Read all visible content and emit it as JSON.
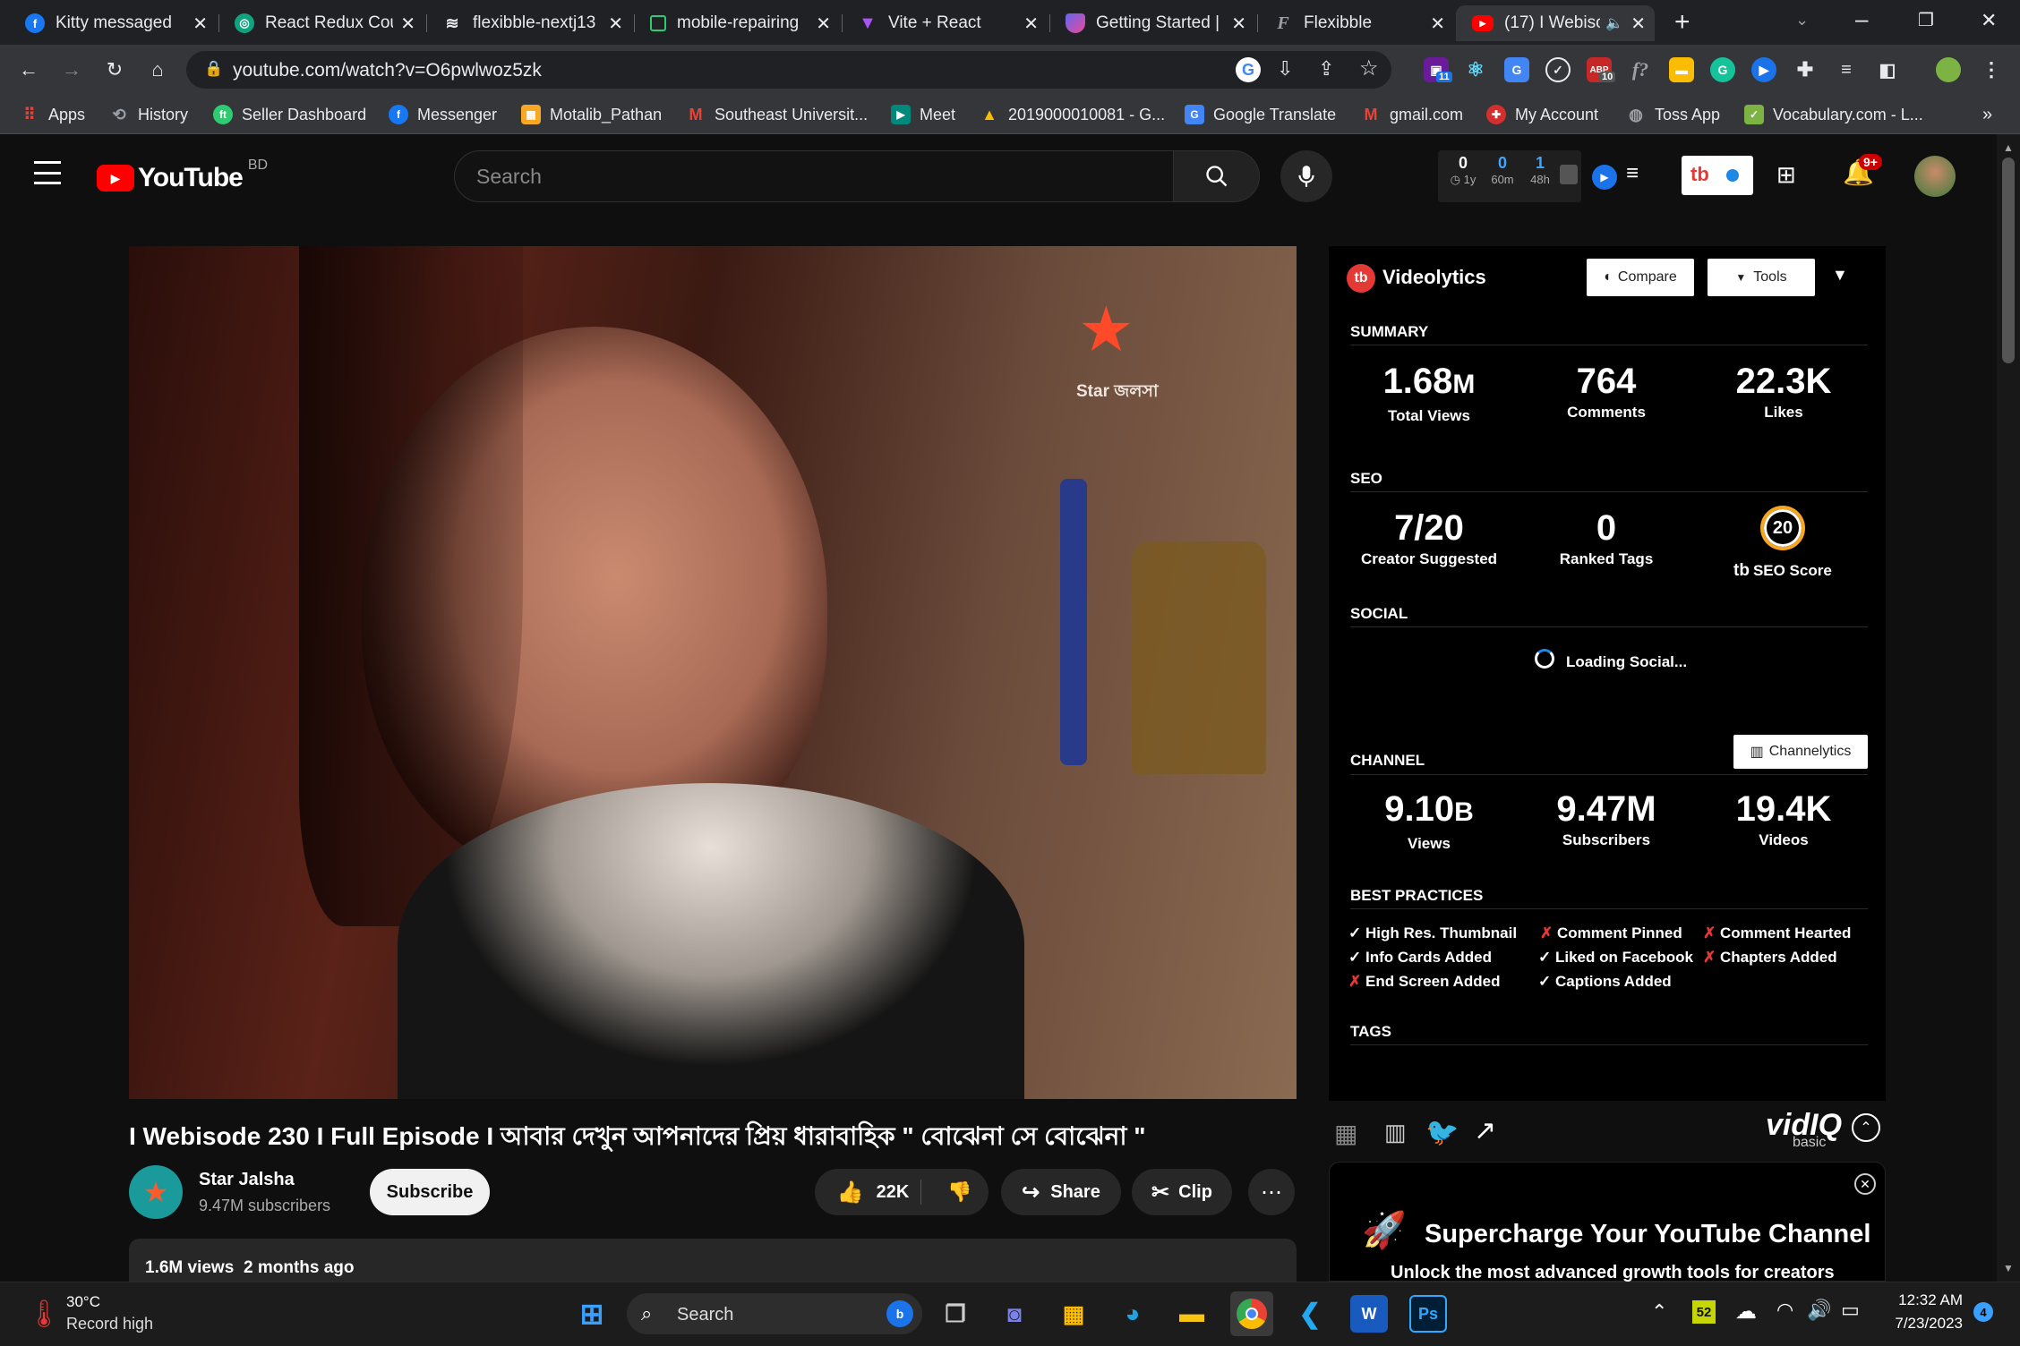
{
  "browser": {
    "tabs": [
      {
        "title": "Kitty messaged",
        "icon": "facebook-icon",
        "color": "#1877f2"
      },
      {
        "title": "React Redux Cou",
        "icon": "chatgpt-icon",
        "color": "#10a37f"
      },
      {
        "title": "flexibble-nextj13",
        "icon": "layers-icon",
        "color": "#e8eaed"
      },
      {
        "title": "mobile-repairing",
        "icon": "codesandbox-icon",
        "color": "#2ecc71"
      },
      {
        "title": "Vite + React",
        "icon": "vite-icon",
        "color": "#a855f7"
      },
      {
        "title": "Getting Started |",
        "icon": "shield-icon",
        "color": "#6366f1"
      },
      {
        "title": "Flexibble",
        "icon": "flexibble-icon",
        "color": "#9aa0a6"
      },
      {
        "title": "(17) I Webisc",
        "icon": "youtube-icon",
        "color": "#ff0000"
      }
    ],
    "url": "youtube.com/watch?v=O6pwlwoz5zk",
    "bookmarks": [
      {
        "label": "Apps",
        "icon": "apps-grid-icon",
        "color": "#ea4335"
      },
      {
        "label": "History",
        "icon": "history-icon",
        "color": "#9aa0a6"
      },
      {
        "label": "Seller Dashboard",
        "icon": "seller-icon",
        "color": "#2ecc71"
      },
      {
        "label": "Messenger",
        "icon": "facebook-icon",
        "color": "#1877f2"
      },
      {
        "label": "Motalib_Pathan",
        "icon": "bookmark-image-icon",
        "color": "#f9a825"
      },
      {
        "label": "Southeast Universit...",
        "icon": "gmail-icon",
        "color": "#ea4335"
      },
      {
        "label": "Meet",
        "icon": "meet-icon",
        "color": "#00897b"
      },
      {
        "label": "2019000010081 - G...",
        "icon": "drive-icon",
        "color": "#fbbc04"
      },
      {
        "label": "Google Translate",
        "icon": "translate-icon",
        "color": "#4285f4"
      },
      {
        "label": "gmail.com",
        "icon": "gmail-icon",
        "color": "#ea4335"
      },
      {
        "label": "My Account",
        "icon": "account-icon",
        "color": "#d32f2f"
      },
      {
        "label": "Toss App",
        "icon": "globe-icon",
        "color": "#9aa0a6"
      },
      {
        "label": "Vocabulary.com - L...",
        "icon": "vocabulary-icon",
        "color": "#7cb342"
      }
    ],
    "bookmarks_more": "»",
    "ext_badges": {
      "calendar": "11",
      "abp": "10"
    }
  },
  "youtube": {
    "logo_text": "YouTube",
    "country": "BD",
    "search_placeholder": "Search",
    "counters": [
      {
        "value": "0",
        "label": "1y",
        "color": "#f9a825"
      },
      {
        "value": "0",
        "label": "60m",
        "color": "#3ea6ff"
      },
      {
        "value": "1",
        "label": "48h",
        "color": "#3ea6ff"
      }
    ],
    "notifications_badge": "9+"
  },
  "video": {
    "watermark": "Star জলসা",
    "title": "I Webisode 230 I Full Episode I আবার দেখুন আপনাদের প্রিয় ধারাবাহিক \" বোঝেনা সে বোঝেনা \"",
    "channel": "Star Jalsha",
    "subscribers": "9.47M subscribers",
    "subscribe_label": "Subscribe",
    "likes": "22K",
    "share_label": "Share",
    "clip_label": "Clip",
    "views": "1.6M views",
    "age": "2 months ago"
  },
  "vidiq": {
    "title": "Videolytics",
    "compare_label": "Compare",
    "tools_label": "Tools",
    "summary": {
      "heading": "SUMMARY",
      "views": "1.68",
      "views_unit": "M",
      "views_label": "Total Views",
      "comments": "764",
      "comments_label": "Comments",
      "likes": "22.3K",
      "likes_label": "Likes"
    },
    "seo": {
      "heading": "SEO",
      "creator": "7/20",
      "creator_label": "Creator Suggested",
      "ranked": "0",
      "ranked_label": "Ranked Tags",
      "score": "20",
      "score_label": "SEO Score"
    },
    "social": {
      "heading": "SOCIAL",
      "loading": "Loading Social..."
    },
    "channel": {
      "heading": "CHANNEL",
      "button": "Channelytics",
      "views": "9.10",
      "views_unit": "B",
      "views_label": "Views",
      "subs": "9.47M",
      "subs_label": "Subscribers",
      "videos": "19.4K",
      "videos_label": "Videos"
    },
    "best_practices": {
      "heading": "BEST PRACTICES",
      "items": [
        {
          "label": "High Res. Thumbnail",
          "ok": true
        },
        {
          "label": "Comment Pinned",
          "ok": false
        },
        {
          "label": "Comment Hearted",
          "ok": false
        },
        {
          "label": "Info Cards Added",
          "ok": true
        },
        {
          "label": "Liked on Facebook",
          "ok": true
        },
        {
          "label": "Chapters Added",
          "ok": false
        },
        {
          "label": "End Screen Added",
          "ok": false
        },
        {
          "label": "Captions Added",
          "ok": true
        }
      ]
    },
    "tags_heading": "TAGS",
    "brand": "vidIQ",
    "plan": "basic",
    "promo_title": "Supercharge Your YouTube Channel",
    "promo_sub": "Unlock the most advanced growth tools for creators"
  },
  "taskbar": {
    "temp": "30°C",
    "weather_text": "Record high",
    "search_label": "Search",
    "badge_52": "52",
    "time": "12:32 AM",
    "date": "7/23/2023",
    "notif_count": "4"
  }
}
